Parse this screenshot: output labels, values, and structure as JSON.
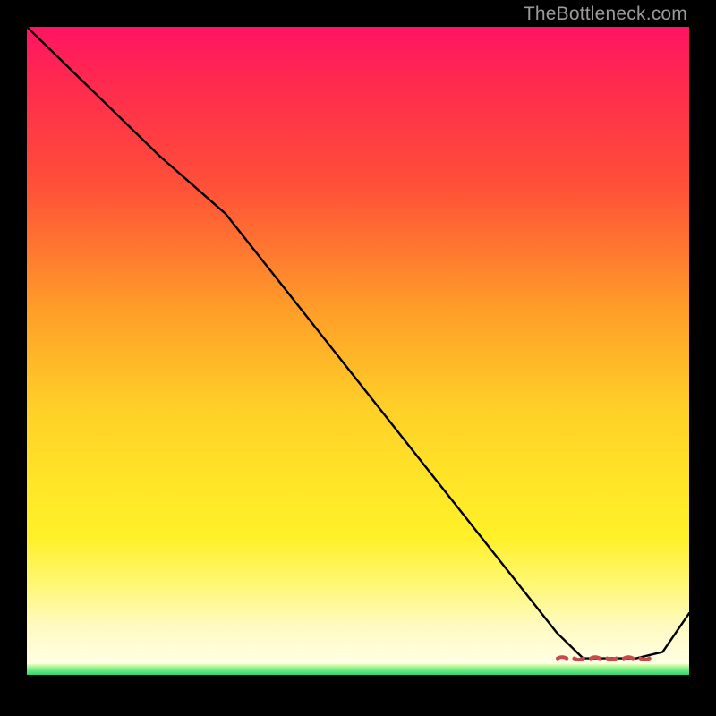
{
  "watermark": "TheBottleneck.com",
  "chart_data": {
    "type": "line",
    "title": "",
    "xlabel": "",
    "ylabel": "",
    "xlim": [
      0,
      100
    ],
    "ylim": [
      0,
      100
    ],
    "grid": false,
    "series": [
      {
        "name": "curve",
        "color": "#000000",
        "x": [
          0,
          10,
          20,
          30,
          40,
          50,
          60,
          70,
          80,
          84,
          88,
          92,
          96,
          100
        ],
        "y": [
          100,
          90,
          80,
          71,
          58,
          45,
          32,
          19,
          6,
          2,
          2,
          2,
          3,
          9
        ]
      }
    ],
    "annotations": [
      {
        "name": "red-scribble",
        "color": "#c94a4a",
        "approx_x_range": [
          80,
          95
        ],
        "approx_y": 2,
        "note": "dashed short wavy mark near valley floor"
      }
    ],
    "background": {
      "type": "vertical-gradient",
      "stops": [
        {
          "pos": 0.0,
          "color": "#ff1464"
        },
        {
          "pos": 0.25,
          "color": "#ff5038"
        },
        {
          "pos": 0.55,
          "color": "#ffd028"
        },
        {
          "pos": 0.85,
          "color": "#fff87a"
        },
        {
          "pos": 0.96,
          "color": "#ffffe6"
        },
        {
          "pos": 0.98,
          "color": "#8cf08c"
        },
        {
          "pos": 1.0,
          "color": "#28d86e"
        }
      ]
    }
  }
}
